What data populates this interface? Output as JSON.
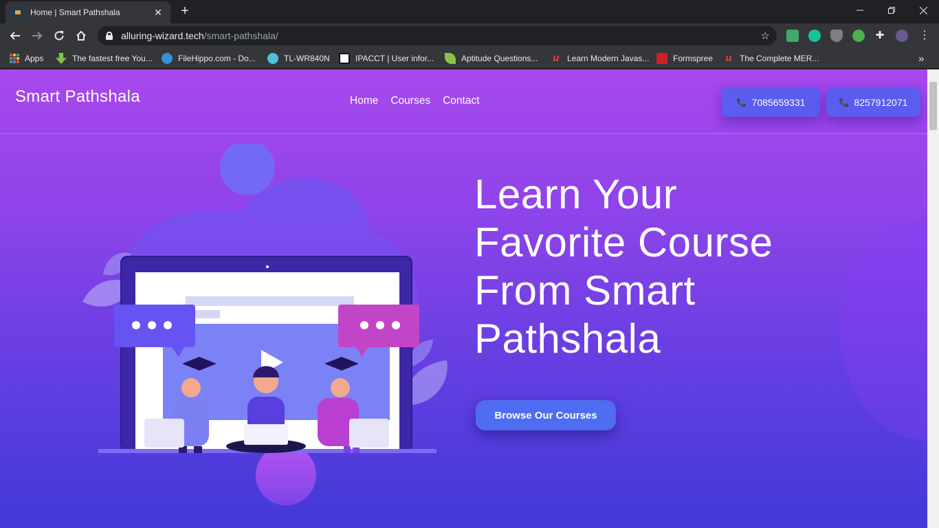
{
  "browser": {
    "tab_title": "Home | Smart Pathshala",
    "close_glyph": "✕",
    "new_tab_glyph": "+",
    "url_host": "alluring-wizard.tech",
    "url_path": "/smart-pathshala/",
    "bookmarks": [
      {
        "label": "Apps",
        "icon": "apps-grid-icon"
      },
      {
        "label": "The fastest free You...",
        "icon": "download-arrow-icon",
        "color": "#7cc444"
      },
      {
        "label": "FileHippo.com - Do...",
        "icon": "filehippo-icon",
        "color": "#3b8fd9"
      },
      {
        "label": "TL-WR840N",
        "icon": "tplink-icon",
        "color": "#4fc3d8"
      },
      {
        "label": "IPACCT | User infor...",
        "icon": "ipacct-icon",
        "color": "#ffffff"
      },
      {
        "label": "Aptitude Questions...",
        "icon": "leaf-icon",
        "color": "#8bc34a"
      },
      {
        "label": "Learn Modern Javas...",
        "icon": "udemy-icon",
        "color": "#e0463b"
      },
      {
        "label": "Formspree",
        "icon": "formspree-icon",
        "color": "#d01f2c"
      },
      {
        "label": "The Complete MER...",
        "icon": "udemy-icon",
        "color": "#e0463b"
      }
    ],
    "more_glyph": "»"
  },
  "site": {
    "brand": "Smart Pathshala",
    "nav": [
      "Home",
      "Courses",
      "Contact"
    ],
    "phones": [
      "7085659331",
      "8257912071"
    ],
    "hero_lines": [
      "Learn Your",
      "Favorite Course",
      "From Smart",
      "Pathshala"
    ],
    "cta": "Browse Our Courses"
  },
  "colors": {
    "accent": "#5b5cf0",
    "cta": "#4e6df0",
    "bg_top": "#a748ec",
    "bg_bottom": "#4438d8"
  }
}
